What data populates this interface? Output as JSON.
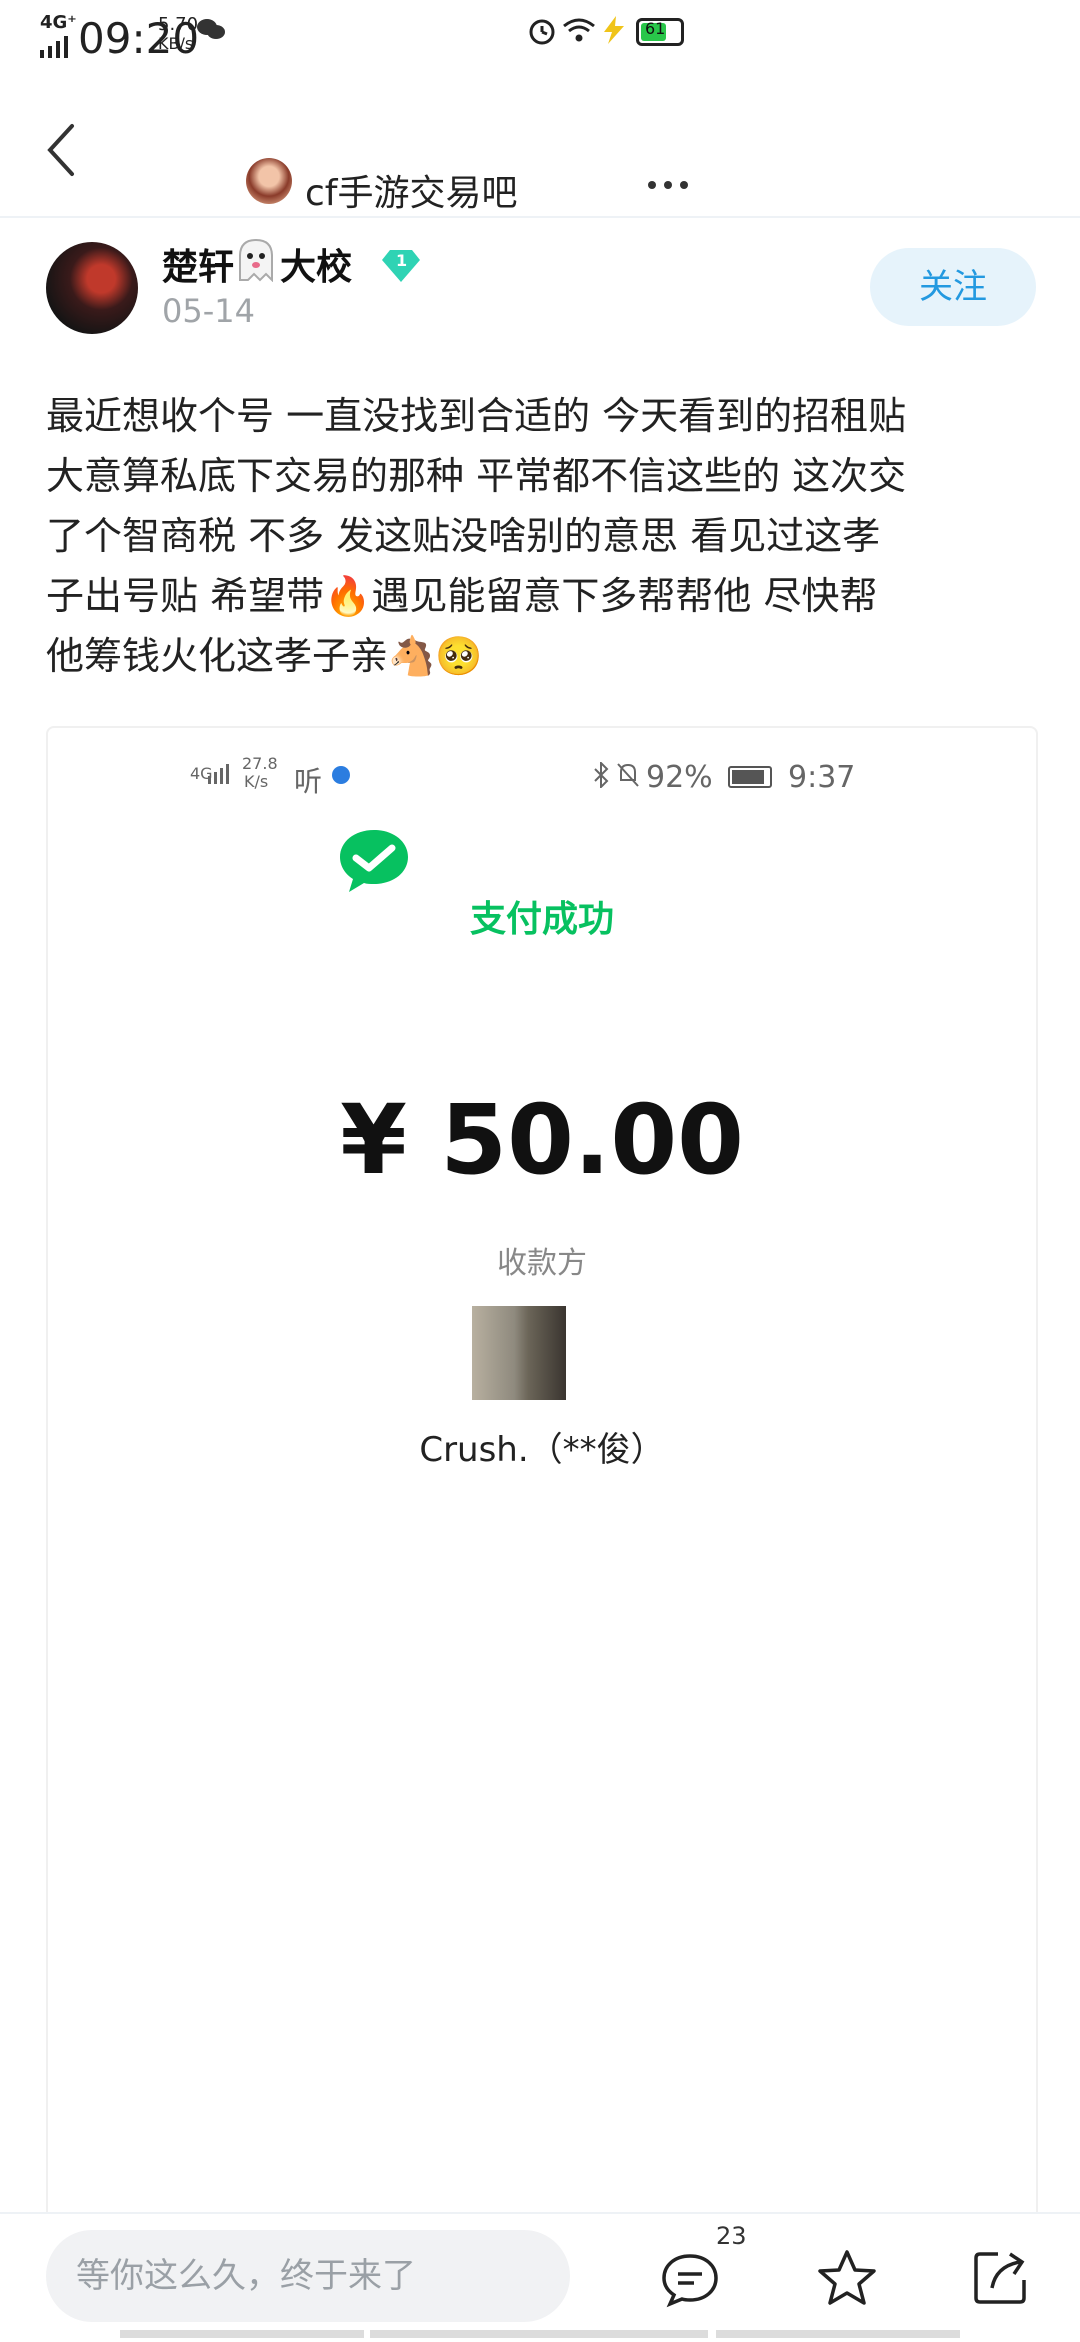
{
  "status_bar": {
    "network": "4G⁺",
    "time": "09:20",
    "speed_value": "5.70",
    "speed_unit": "KB/s",
    "battery": "61"
  },
  "header": {
    "title": "cf手游交易吧"
  },
  "post": {
    "author": "楚轩",
    "author_suffix": "大校",
    "badge_level": "1",
    "date": "05-14",
    "follow_label": "关注",
    "content_lines": [
      "最近想收个号 一直没找到合适的 今天看到的招租贴",
      "大意算私底下交易的那种 平常都不信这些的 这次交",
      "了个智商税 不多 发这贴没啥别的意思 看见过这孝",
      "子出号贴 希望带🔥遇见能留意下多帮帮他 尽快帮",
      "他筹钱火化这孝子亲🐴🥺"
    ]
  },
  "screenshot": {
    "status": {
      "signal": "4G",
      "speed_value": "27.8",
      "speed_unit": "K/s",
      "app_glyph": "听",
      "battery": "92%",
      "time": "9:37"
    },
    "pay_status": "支付成功",
    "amount": "¥ 50.00",
    "payee_label": "收款方",
    "payee_name": "Crush.（**俊）"
  },
  "bottom_bar": {
    "comment_placeholder": "等你这么久，终于来了",
    "comment_count": "23"
  },
  "colors": {
    "accent_blue": "#2399e0",
    "wechat_green": "#07c160",
    "badge_teal": "#2fd3b4"
  }
}
